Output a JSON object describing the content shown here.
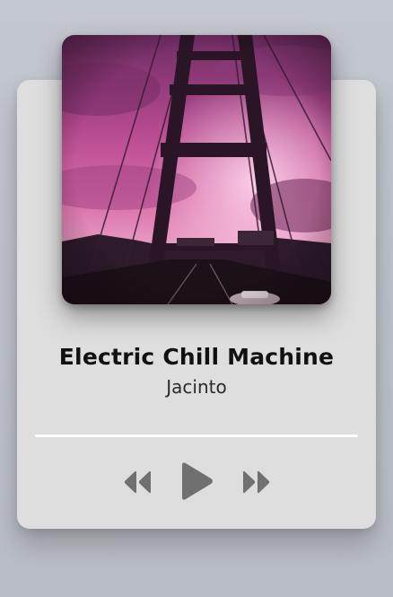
{
  "player": {
    "track_title": "Electric Chill Machine",
    "artist": "Jacinto",
    "progress_fraction": 0,
    "album_art": "bridge-sunset-photo"
  },
  "controls": {
    "previous": "rewind-icon",
    "play": "play-icon",
    "next": "fast-forward-icon"
  },
  "colors": {
    "background": "#c0c4cb",
    "card": "#dedede",
    "progress_track": "#ffffff",
    "icon": "#707070",
    "title_text": "#111111",
    "album_tint": "#c2448a"
  }
}
